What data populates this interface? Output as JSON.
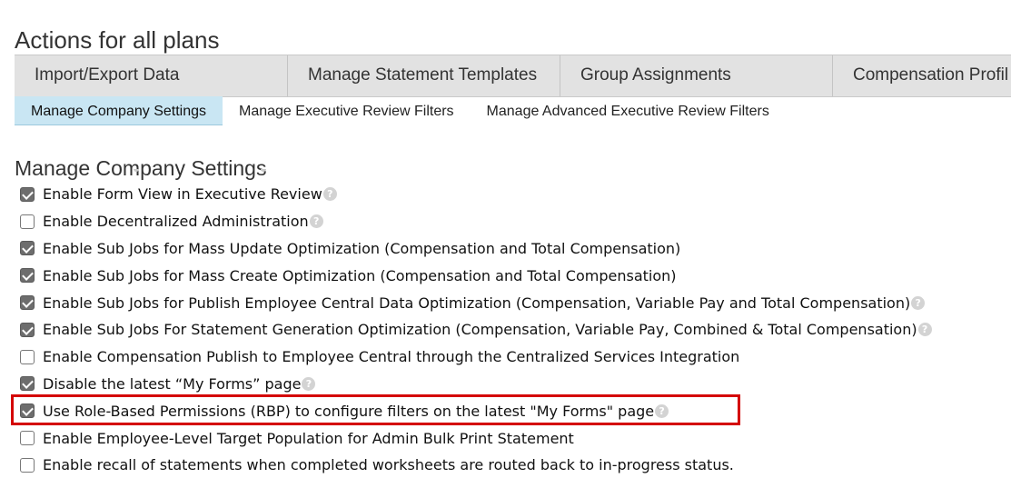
{
  "page": {
    "title": "Actions for all plans"
  },
  "tabs": [
    {
      "label": "Import/Export Data"
    },
    {
      "label": "Manage Statement Templates"
    },
    {
      "label": "Group Assignments"
    },
    {
      "label": "Compensation Profil"
    }
  ],
  "subtabs": [
    {
      "label": "Manage Company Settings",
      "active": true
    },
    {
      "label": "Manage Executive Review Filters",
      "active": false
    },
    {
      "label": "Manage Advanced Executive Review Filters",
      "active": false
    }
  ],
  "section": {
    "title": "Manage Company Settings"
  },
  "options": [
    {
      "label": "Enable Form View in Executive Review",
      "checked": true,
      "help": true
    },
    {
      "label": "Enable Decentralized Administration",
      "checked": false,
      "help": true
    },
    {
      "label": "Enable Sub Jobs for Mass Update Optimization (Compensation and Total Compensation)",
      "checked": true,
      "help": false
    },
    {
      "label": "Enable Sub Jobs for Mass Create Optimization (Compensation and Total Compensation)",
      "checked": true,
      "help": false
    },
    {
      "label": "Enable Sub Jobs for Publish Employee Central Data Optimization (Compensation, Variable Pay and Total Compensation)",
      "checked": true,
      "help": true
    },
    {
      "label": "Enable Sub Jobs For Statement Generation Optimization (Compensation, Variable Pay, Combined & Total Compensation)",
      "checked": true,
      "help": true
    },
    {
      "label": "Enable Compensation Publish to Employee Central through the Centralized Services Integration",
      "checked": false,
      "help": false
    },
    {
      "label": "Disable the latest “My Forms” page",
      "checked": true,
      "help": true
    },
    {
      "label": "Use Role-Based Permissions (RBP) to configure filters on the latest \"My Forms\" page",
      "checked": true,
      "help": true,
      "highlighted": true
    },
    {
      "label": "Enable Employee-Level Target Population for Admin Bulk Print Statement",
      "checked": false,
      "help": false
    },
    {
      "label": "Enable recall of statements when completed worksheets are routed back to in-progress status.",
      "checked": false,
      "help": false
    }
  ],
  "help_icon_glyph": "?",
  "colors": {
    "highlight": "#d40000",
    "active_subtab": "#c9e6f3",
    "tabbar": "#e2e2e2"
  }
}
